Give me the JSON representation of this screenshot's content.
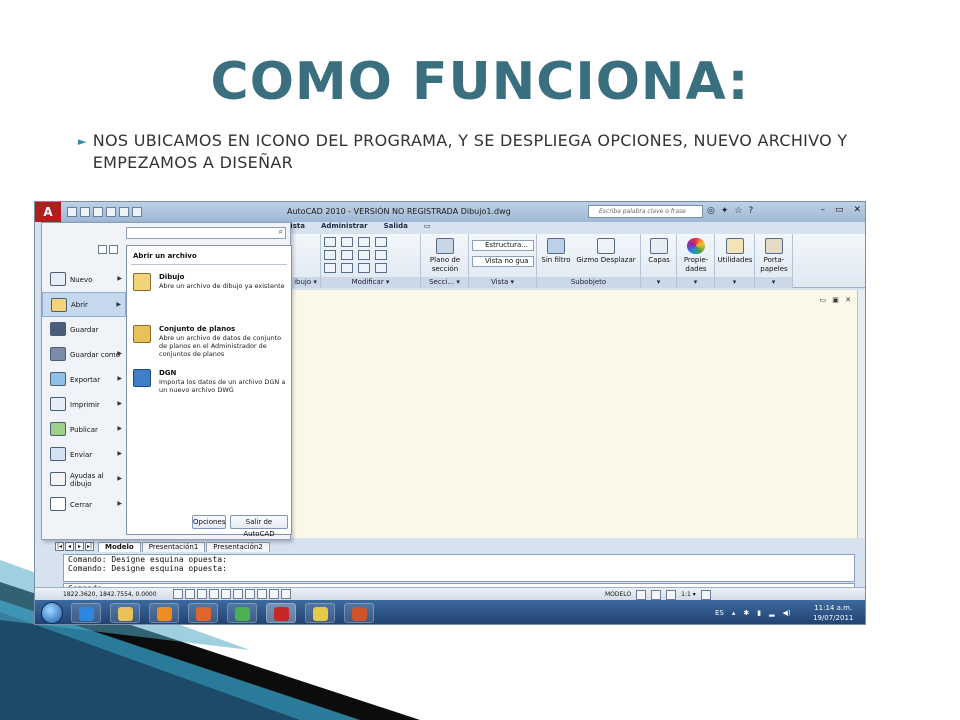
{
  "slide": {
    "title": "COMO FUNCIONA:",
    "bullet": "NOS UBICAMOS EN ICONO DEL PROGRAMA, Y SE DESPLIEGA OPCIONES, NUEVO ARCHIVO Y EMPEZAMOS A DISEÑAR"
  },
  "window": {
    "title": "AutoCAD 2010 - VERSIÓN NO REGISTRADA     Dibujo1.dwg",
    "search_placeholder": "Escriba palabra clave o frase"
  },
  "ribbon": {
    "tabs": [
      "Vista",
      "Administrar",
      "Salida"
    ],
    "groups": {
      "dibujo": "ibujo ▾",
      "modificar": "Modificar ▾",
      "seccion": "Secci... ▾",
      "vista": "Vista ▾",
      "subobjeto": "Subobjeto"
    },
    "buttons": {
      "plano": "Plano de sección",
      "estructura": "Estructura...",
      "vista_no_guardada": "Vista no gua",
      "sin_filtro": "Sin filtro",
      "gizmo": "Gizmo Desplazar",
      "capas": "Capas",
      "propiedades": "Propie- dades",
      "utilidades": "Utilidades",
      "portapapeles": "Porta- papeles"
    }
  },
  "app_menu": {
    "left_items": [
      {
        "label": "Nuevo"
      },
      {
        "label": "Abrir"
      },
      {
        "label": "Guardar"
      },
      {
        "label": "Guardar como"
      },
      {
        "label": "Exportar"
      },
      {
        "label": "Imprimir"
      },
      {
        "label": "Publicar"
      },
      {
        "label": "Enviar"
      },
      {
        "label": "Ayudas al dibujo"
      },
      {
        "label": "Cerrar"
      }
    ],
    "submenu_title": "Abrir un archivo",
    "submenu_items": [
      {
        "title": "Dibujo",
        "desc": "Abre un archivo de dibujo ya existente"
      },
      {
        "title": "Conjunto de planos",
        "desc": "Abre un archivo de datos de conjunto de planos en el Administrador de conjuntos de planos"
      },
      {
        "title": "DGN",
        "desc": "Importa los datos de un archivo DGN a un nuevo archivo DWG"
      }
    ],
    "options_button": "Opciones",
    "exit_button": "Salir de AutoCAD"
  },
  "layout_tabs": [
    "Modelo",
    "Presentación1",
    "Presentación2"
  ],
  "command_line": {
    "lines": [
      "Comando: Designe esquina opuesta:",
      "Comando: Designe esquina opuesta:"
    ],
    "prompt": "Comando:"
  },
  "status": {
    "coords": "1822.3620, 1842.7554, 0.0000",
    "model": "MODELO",
    "scale": "1:1 ▾"
  },
  "taskbar": {
    "lang": "ES",
    "time": "11:14 a.m.",
    "date": "19/07/2011"
  },
  "colors": {
    "title": "#3a6f80",
    "accent": "#2f8ea5",
    "autocad_red": "#b01e1e"
  }
}
